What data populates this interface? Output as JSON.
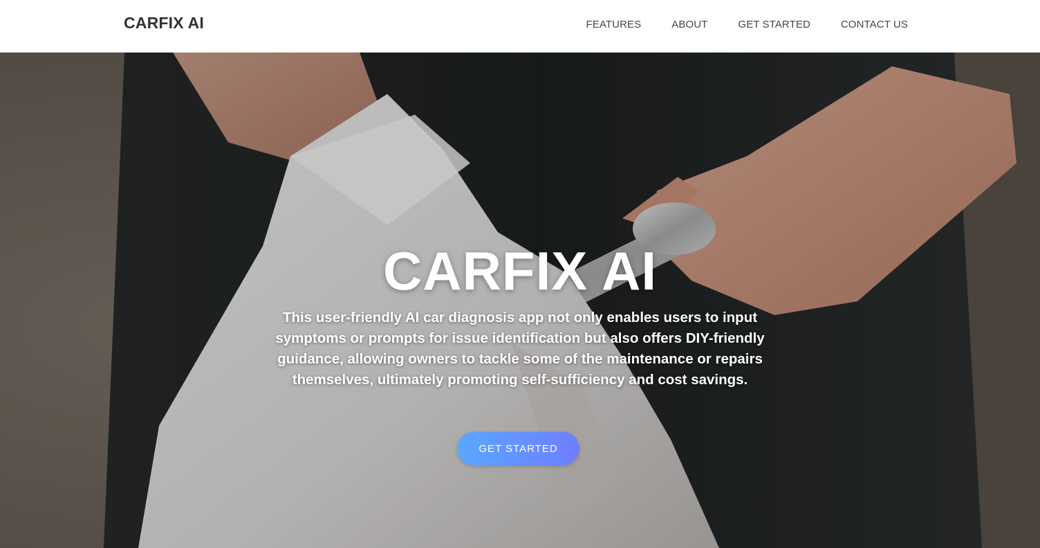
{
  "navbar": {
    "brand": "CARFIX AI",
    "links": [
      {
        "label": "FEATURES"
      },
      {
        "label": "ABOUT"
      },
      {
        "label": "GET STARTED"
      },
      {
        "label": "CONTACT US"
      }
    ]
  },
  "hero": {
    "title": "CARFIX AI",
    "description": "This user-friendly AI car diagnosis app not only enables users to input symptoms or prompts for issue identification but also offers DIY-friendly guidance, allowing owners to tackle some of the maintenance or repairs themselves, ultimately promoting self-sufficiency and cost savings.",
    "cta_label": "GET STARTED",
    "background_image": "mechanic-holding-wrench-with-towel",
    "cta_gradient": [
      "#5aa8ff",
      "#6f7dff"
    ]
  }
}
